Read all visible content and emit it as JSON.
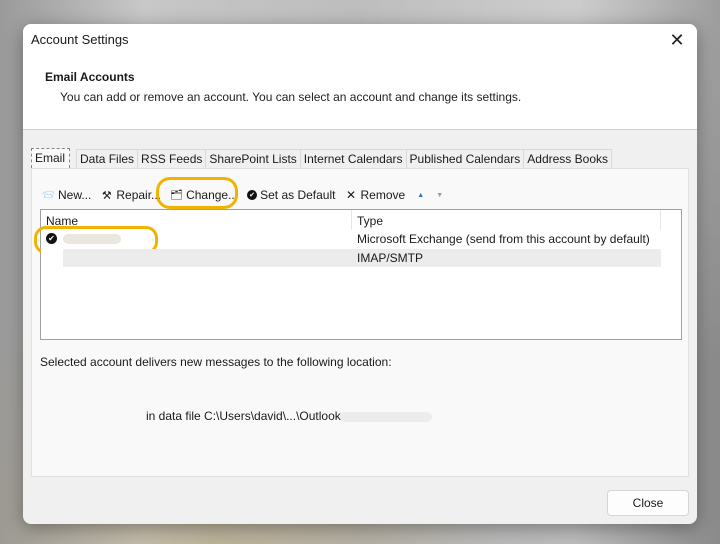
{
  "window": {
    "title": "Account Settings",
    "close_glyph": "✕"
  },
  "header": {
    "title": "Email Accounts",
    "description": "You can add or remove an account. You can select an account and change its settings."
  },
  "tabs": [
    {
      "label": "Email",
      "active": true
    },
    {
      "label": "Data Files"
    },
    {
      "label": "RSS Feeds"
    },
    {
      "label": "SharePoint Lists"
    },
    {
      "label": "Internet Calendars"
    },
    {
      "label": "Published Calendars"
    },
    {
      "label": "Address Books"
    }
  ],
  "toolbar": {
    "new_label": "New...",
    "repair_label": "Repair...",
    "change_label": "Change...",
    "set_default_label": "Set as Default",
    "remove_label": "Remove",
    "icons": {
      "new": "📨",
      "repair": "⚒",
      "change": "🗂",
      "set_default": "✔",
      "remove": "✕",
      "move_up": "▲",
      "move_down": "▼"
    },
    "colors": {
      "move_up": "#2f6fd1",
      "move_down": "#9a9a9a"
    }
  },
  "accounts_list": {
    "columns": [
      "Name",
      "Type"
    ],
    "rows": [
      {
        "name": "",
        "type": "Microsoft Exchange (send from this account by default)",
        "default": true,
        "default_glyph": "✔"
      },
      {
        "name": "",
        "type": "IMAP/SMTP",
        "default": false
      }
    ]
  },
  "delivery": {
    "label": "Selected account delivers new messages to the following location:",
    "data_file": "in data file C:\\Users\\david\\...\\Outlook"
  },
  "footer": {
    "close_label": "Close"
  },
  "annotation_color": "#f0b400"
}
